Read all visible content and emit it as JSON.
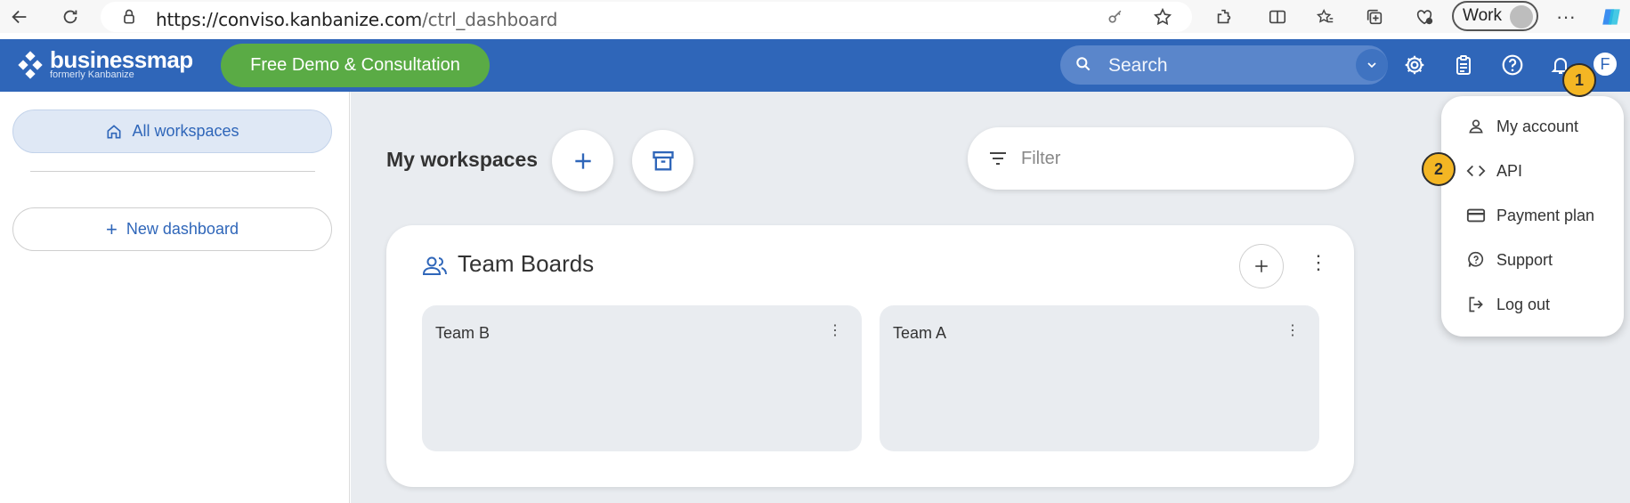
{
  "browser": {
    "url_host": "https://conviso.kanbanize.com",
    "url_path": "/ctrl_dashboard",
    "profile_label": "Work",
    "icons": [
      "back-icon",
      "reload-icon",
      "lock-icon",
      "key-icon",
      "star-icon",
      "extensions-icon",
      "split-screen-icon",
      "favorites-icon",
      "collections-icon",
      "health-icon",
      "more-icon",
      "copilot-icon"
    ]
  },
  "header": {
    "logo_name": "businessmap",
    "logo_sub": "formerly Kanbanize",
    "demo_label": "Free Demo & Consultation",
    "search_placeholder": "Search",
    "avatar_initial": "F",
    "brand_color": "#2f66b9",
    "demo_color": "#5aab45"
  },
  "sidebar": {
    "all_workspaces": "All workspaces",
    "new_dashboard": "New dashboard"
  },
  "main": {
    "title": "My workspaces",
    "filter_placeholder": "Filter",
    "panel": {
      "title": "Team Boards",
      "boards": [
        {
          "name": "Team B"
        },
        {
          "name": "Team A"
        }
      ]
    }
  },
  "account_menu": {
    "items": [
      {
        "label": "My account",
        "icon": "user-icon"
      },
      {
        "label": "API",
        "icon": "code-icon"
      },
      {
        "label": "Payment plan",
        "icon": "credit-card-icon"
      },
      {
        "label": "Support",
        "icon": "help-icon"
      },
      {
        "label": "Log out",
        "icon": "logout-icon"
      }
    ]
  },
  "annotations": {
    "step1": "1",
    "step2": "2",
    "color": "#f4b624"
  }
}
